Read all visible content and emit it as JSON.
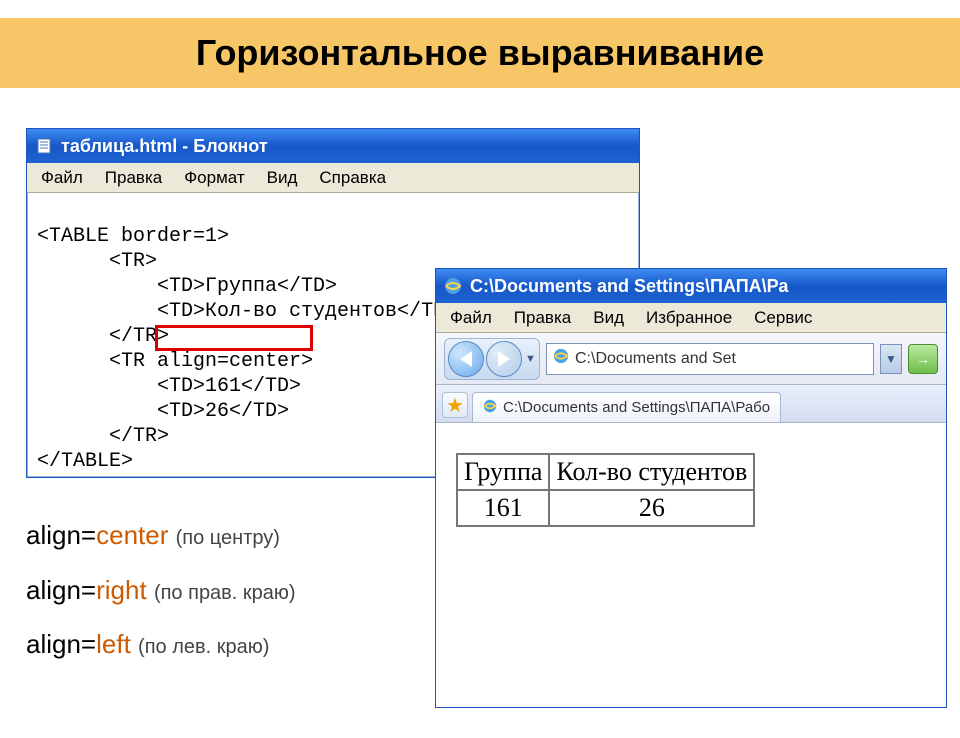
{
  "slide": {
    "title": "Горизонтальное выравнивание"
  },
  "notepad": {
    "title": "таблица.html - Блокнот",
    "menu": {
      "file": "Файл",
      "edit": "Правка",
      "format": "Формат",
      "view": "Вид",
      "help": "Справка"
    },
    "code_lines": [
      "<TABLE border=1>",
      "      <TR>",
      "          <TD>Группа</TD>",
      "          <TD>Кол-во студентов</TD>|",
      "      </TR>",
      "      <TR align=center>",
      "          <TD>161</TD>",
      "          <TD>26</TD>",
      "      </TR>",
      "</TABLE>"
    ],
    "highlight_text": "align=center"
  },
  "ie": {
    "title": "C:\\Documents and Settings\\ПАПА\\Ра",
    "menu": {
      "file": "Файл",
      "edit": "Правка",
      "view": "Вид",
      "favorites": "Избранное",
      "tools": "Сервис"
    },
    "address_text": "C:\\Documents and Set",
    "tab_text": "C:\\Documents and Settings\\ПАПА\\Рабо",
    "table": {
      "headers": [
        "Группа",
        "Кол-во студентов"
      ],
      "row": [
        "161",
        "26"
      ]
    }
  },
  "legend": {
    "items": [
      {
        "attr": "align=",
        "value": "center",
        "desc": "(по центру)"
      },
      {
        "attr": "align=",
        "value": "right",
        "desc": "(по прав. краю)"
      },
      {
        "attr": "align=",
        "value": "left",
        "desc": "(по лев. краю)"
      }
    ]
  }
}
